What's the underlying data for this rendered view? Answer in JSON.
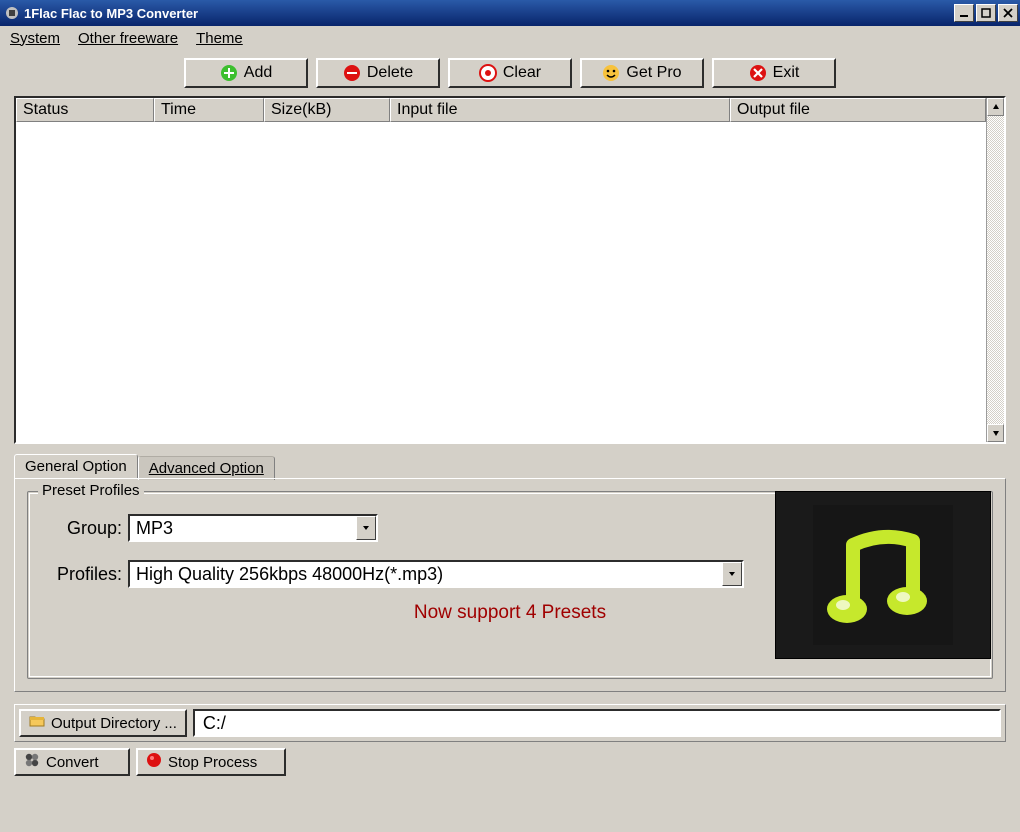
{
  "title": "1Flac Flac to MP3 Converter",
  "menubar": {
    "system": "System",
    "other": "Other freeware",
    "theme": "Theme"
  },
  "toolbar": {
    "add": "Add",
    "delete": "Delete",
    "clear": "Clear",
    "getpro": "Get Pro",
    "exit": "Exit"
  },
  "columns": {
    "status": "Status",
    "time": "Time",
    "size": "Size(kB)",
    "input": "Input file",
    "output": "Output file"
  },
  "tabs": {
    "general": "General Option",
    "advanced": "Advanced Option"
  },
  "preset": {
    "legend": "Preset Profiles",
    "group_label": "Group:",
    "group_value": "MP3",
    "profiles_label": "Profiles:",
    "profiles_value": "High Quality 256kbps 48000Hz(*.mp3)",
    "support_note": "Now support 4 Presets"
  },
  "output": {
    "button": "Output Directory ...",
    "path": "C:/"
  },
  "actions": {
    "convert": "Convert",
    "stop": "Stop Process"
  }
}
